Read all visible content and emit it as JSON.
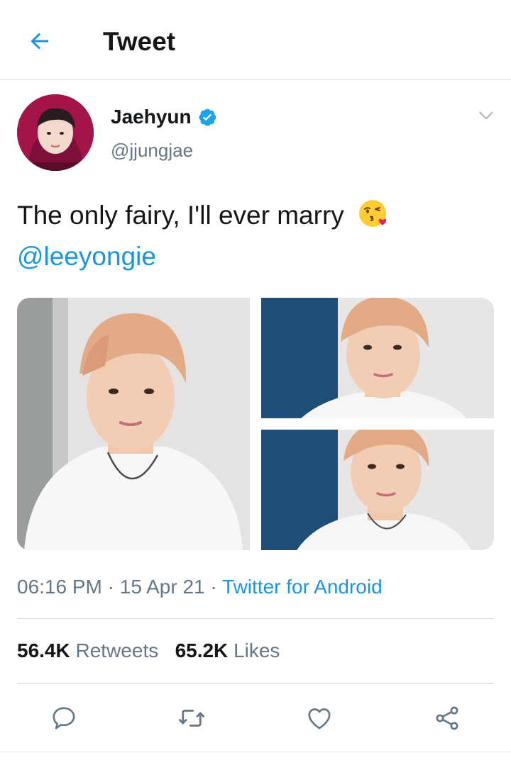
{
  "header": {
    "title": "Tweet",
    "back_icon": "arrow-left-icon"
  },
  "colors": {
    "accent": "#1b95e0",
    "text": "#14171a",
    "secondary": "#657786",
    "border": "#d9dfe3"
  },
  "author": {
    "name": "Jaehyun",
    "handle": "@jjungjae",
    "verified": true
  },
  "tweet": {
    "text": "The only fairy, I'll ever marry",
    "emoji": "face-blowing-kiss",
    "mention": "@leeyongie",
    "photo_count": 3
  },
  "meta": {
    "time": "06:16 PM",
    "date": "15 Apr 21",
    "separator": " · ",
    "source": "Twitter for Android"
  },
  "stats": {
    "retweets_count": "56.4K",
    "retweets_label": "Retweets",
    "likes_count": "65.2K",
    "likes_label": "Likes"
  },
  "actions": [
    "reply-icon",
    "retweet-icon",
    "like-icon",
    "share-icon"
  ]
}
